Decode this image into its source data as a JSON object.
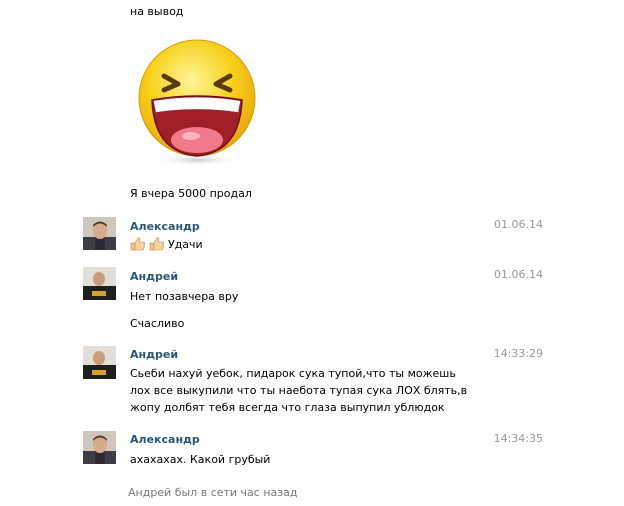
{
  "messages_top": {
    "line1": "на вывод",
    "sticker": "laughing-smiley-sticker",
    "line2": "Я вчера 5000 продал"
  },
  "messages": [
    {
      "author": "Александр",
      "time": "01.06.14",
      "lines": [
        "Удачи"
      ],
      "emoji": "thumbs-up-icon"
    },
    {
      "author": "Андрей",
      "time": "01.06.14",
      "lines": [
        "Нет позавчера вру",
        "Счасливо"
      ]
    },
    {
      "author": "Андрей",
      "time": "14:33:29",
      "text": "Сьеби нахуй уебок, пидарок сука тупой,что ты можешь лох все выкупили что ты наебота тупая сука ЛОХ блять,в жопу долбят тебя всегда что глаза выпупил ублюдок"
    },
    {
      "author": "Александр",
      "time": "14:34:35",
      "text": "ахахахах. Какой грубый"
    }
  ],
  "status": "Андрей был в сети час назад",
  "colors": {
    "author_link": "#2b587a",
    "timestamp": "#999999",
    "status_text": "#777777",
    "sticker_face": "#f7d21c",
    "sticker_mouth": "#b5212a"
  }
}
